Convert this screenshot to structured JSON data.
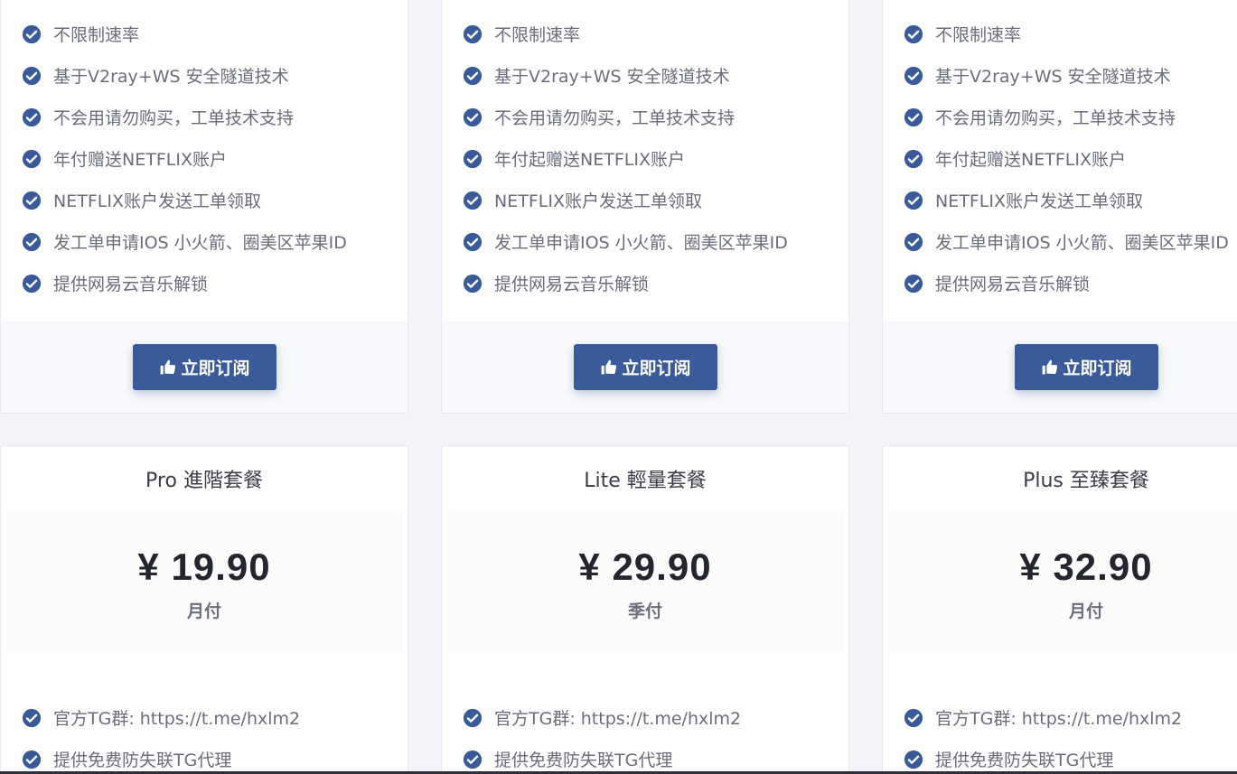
{
  "subscribe_label": "立即订阅",
  "colors": {
    "accent": "#3b5a9a",
    "check": "#3b5a9a"
  },
  "icons": {
    "feature": "check-circle-icon",
    "button": "thumbs-up-icon"
  },
  "top_cards": [
    {
      "features": [
        "不限制速率",
        "基于V2ray+WS 安全隧道技术",
        "不会用请勿购买，工单技术支持",
        "年付赠送NETFLIX账户",
        "NETFLIX账户发送工单领取",
        "发工单申请IOS 小火箭、圈美区苹果ID",
        "提供网易云音乐解锁"
      ]
    },
    {
      "features": [
        "不限制速率",
        "基于V2ray+WS 安全隧道技术",
        "不会用请勿购买，工单技术支持",
        "年付起赠送NETFLIX账户",
        "NETFLIX账户发送工单领取",
        "发工单申请IOS 小火箭、圈美区苹果ID",
        "提供网易云音乐解锁"
      ]
    },
    {
      "features": [
        "不限制速率",
        "基于V2ray+WS 安全隧道技术",
        "不会用请勿购买，工单技术支持",
        "年付起赠送NETFLIX账户",
        "NETFLIX账户发送工单领取",
        "发工单申请IOS 小火箭、圈美区苹果ID",
        "提供网易云音乐解锁"
      ]
    }
  ],
  "bottom_cards": [
    {
      "name": "Pro 進階套餐",
      "price": "¥ 19.90",
      "period": "月付",
      "features": [
        "官方TG群: https://t.me/hxlm2",
        "提供免费防失联TG代理"
      ]
    },
    {
      "name": "Lite 輕量套餐",
      "price": "¥ 29.90",
      "period": "季付",
      "features": [
        "官方TG群: https://t.me/hxlm2",
        "提供免费防失联TG代理"
      ]
    },
    {
      "name": "Plus 至臻套餐",
      "price": "¥ 32.90",
      "period": "月付",
      "features": [
        "官方TG群: https://t.me/hxlm2",
        "提供免费防失联TG代理"
      ]
    }
  ]
}
